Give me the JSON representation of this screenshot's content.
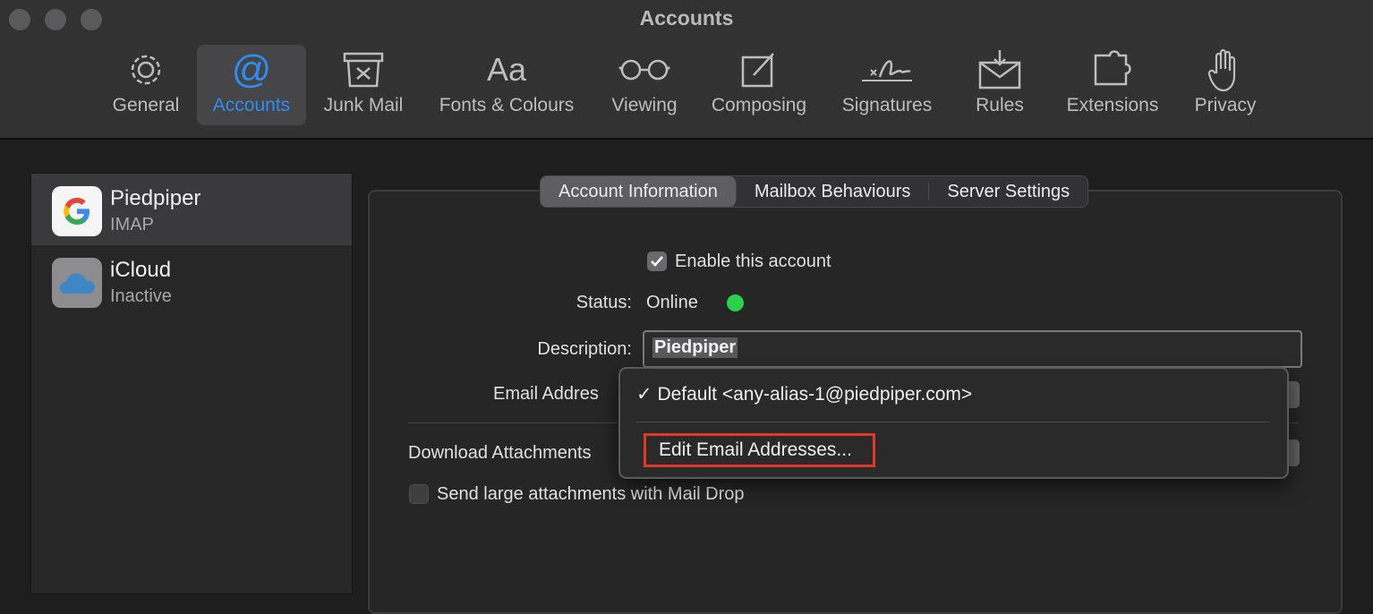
{
  "window": {
    "title": "Accounts"
  },
  "toolbar": {
    "items": [
      {
        "label": "General",
        "icon": "gear-icon"
      },
      {
        "label": "Accounts",
        "icon": "at-sign-icon"
      },
      {
        "label": "Junk Mail",
        "icon": "junk-bin-icon"
      },
      {
        "label": "Fonts & Colours",
        "icon": "font-aa-icon"
      },
      {
        "label": "Viewing",
        "icon": "glasses-icon"
      },
      {
        "label": "Composing",
        "icon": "compose-icon"
      },
      {
        "label": "Signatures",
        "icon": "signature-icon"
      },
      {
        "label": "Rules",
        "icon": "rules-envelope-icon"
      },
      {
        "label": "Extensions",
        "icon": "puzzle-icon"
      },
      {
        "label": "Privacy",
        "icon": "hand-icon"
      }
    ],
    "active_color": "#2f8cf2"
  },
  "sidebar": {
    "accounts": [
      {
        "name": "Piedpiper",
        "subtitle": "IMAP",
        "icon": "google-icon",
        "selected": true
      },
      {
        "name": "iCloud",
        "subtitle": "Inactive",
        "icon": "icloud-icon",
        "selected": false
      }
    ]
  },
  "tabs": [
    {
      "label": "Account Information",
      "active": true
    },
    {
      "label": "Mailbox Behaviours",
      "active": false
    },
    {
      "label": "Server Settings",
      "active": false
    }
  ],
  "form": {
    "enable_label": "Enable this account",
    "enable_checked": true,
    "status_label": "Status:",
    "status_value": "Online",
    "status_color": "#2bd14a",
    "description_label": "Description:",
    "description_value": "Piedpiper",
    "email_label": "Email Addres",
    "download_label": "Download Attachments",
    "maildrop_label": "Send large attachments with Mail Drop",
    "maildrop_checked": false
  },
  "menu": {
    "default_item": "Default <any-alias-1@piedpiper.com>",
    "edit_item": "Edit Email Addresses...",
    "highlight_color": "#e0392b"
  }
}
